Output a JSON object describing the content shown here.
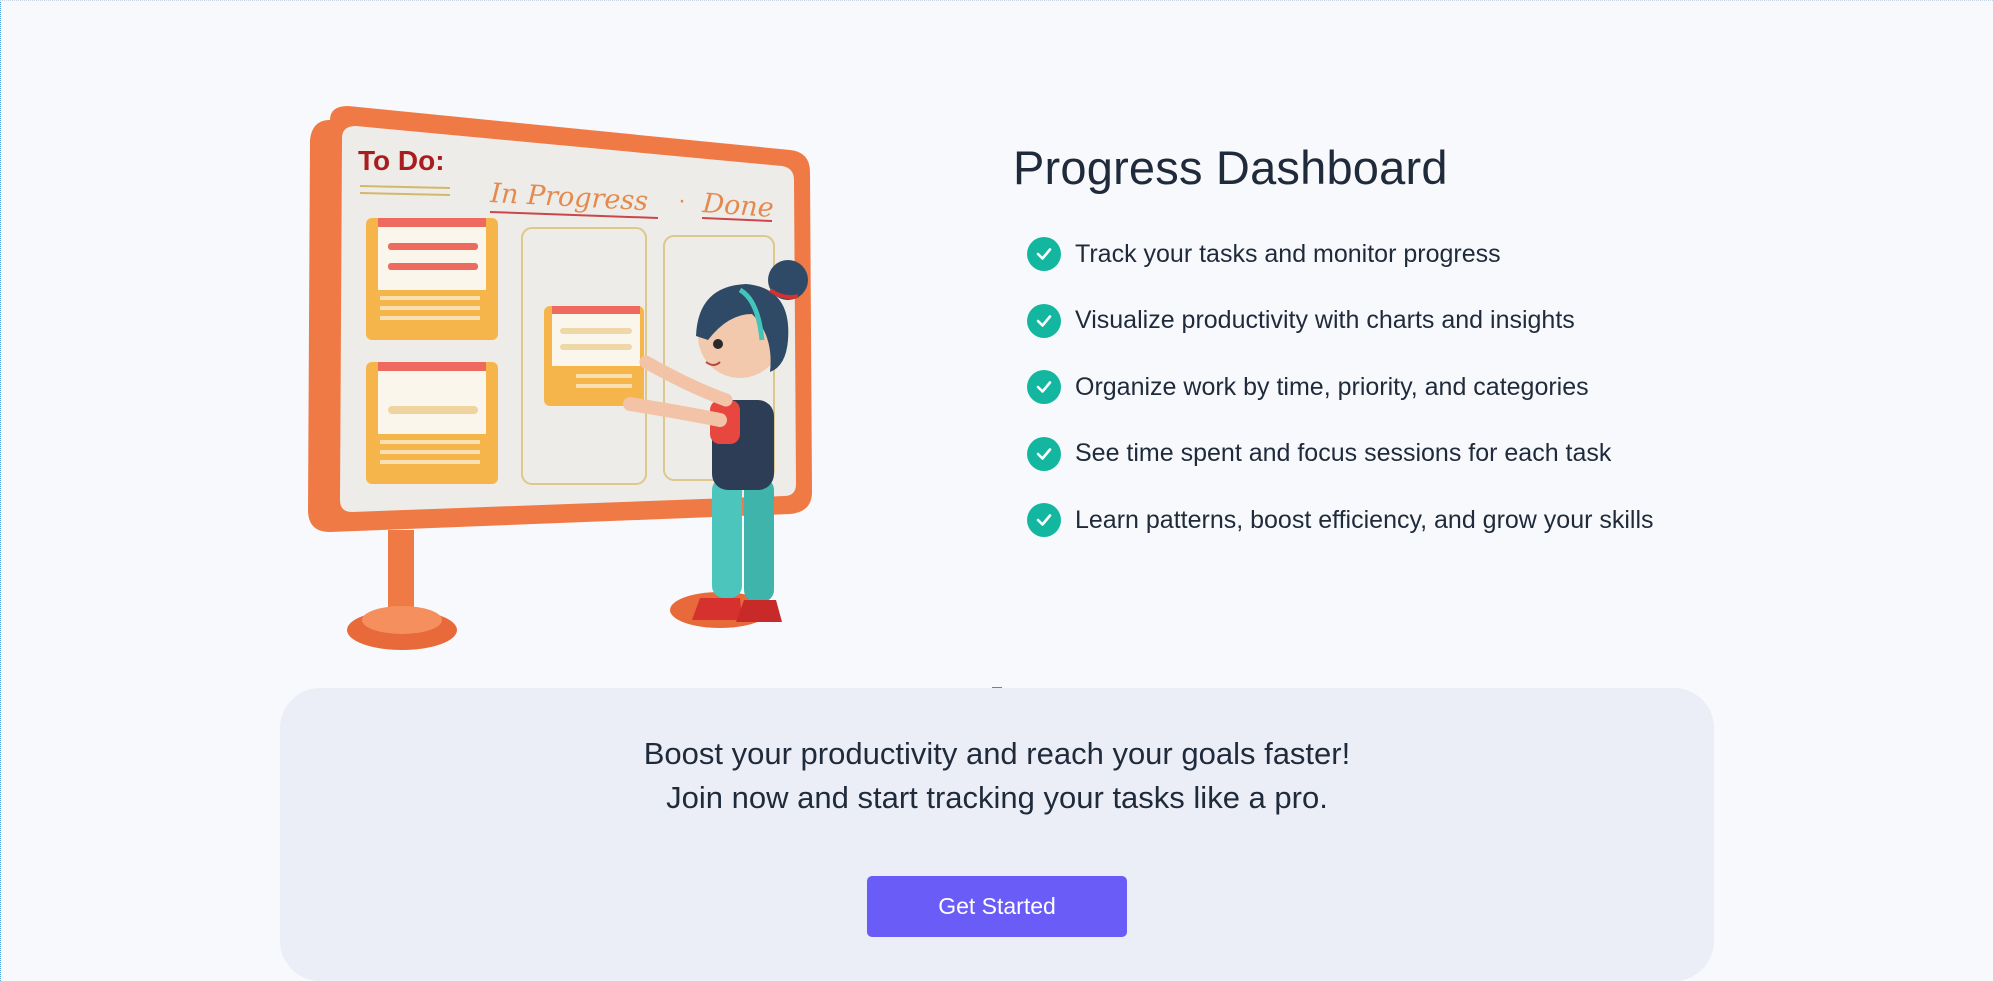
{
  "features": {
    "title": "Progress Dashboard",
    "items": [
      {
        "label": "Track your tasks and monitor progress",
        "icon": "check-circle-icon"
      },
      {
        "label": "Visualize productivity with charts and insights",
        "icon": "check-circle-icon"
      },
      {
        "label": "Organize work by time, priority, and categories",
        "icon": "check-circle-icon"
      },
      {
        "label": "See time spent and focus sessions for each task",
        "icon": "check-circle-icon"
      },
      {
        "label": "Learn patterns, boost efficiency, and grow your skills",
        "icon": "check-circle-icon"
      }
    ]
  },
  "illustration": {
    "board_todo": "To Do:",
    "board_in_progress": "In Progress",
    "board_separator": "·",
    "board_done": "Done"
  },
  "cta": {
    "line1": "Boost your productivity and reach your goals faster!",
    "line2": "Join now and start tracking your tasks like a pro.",
    "button_label": "Get Started"
  },
  "colors": {
    "background": "#f7f9fc",
    "accent": "#6a5cf6",
    "check": "#13b7a0",
    "cta_panel": "#eceef7",
    "board_frame": "#f07a45"
  }
}
